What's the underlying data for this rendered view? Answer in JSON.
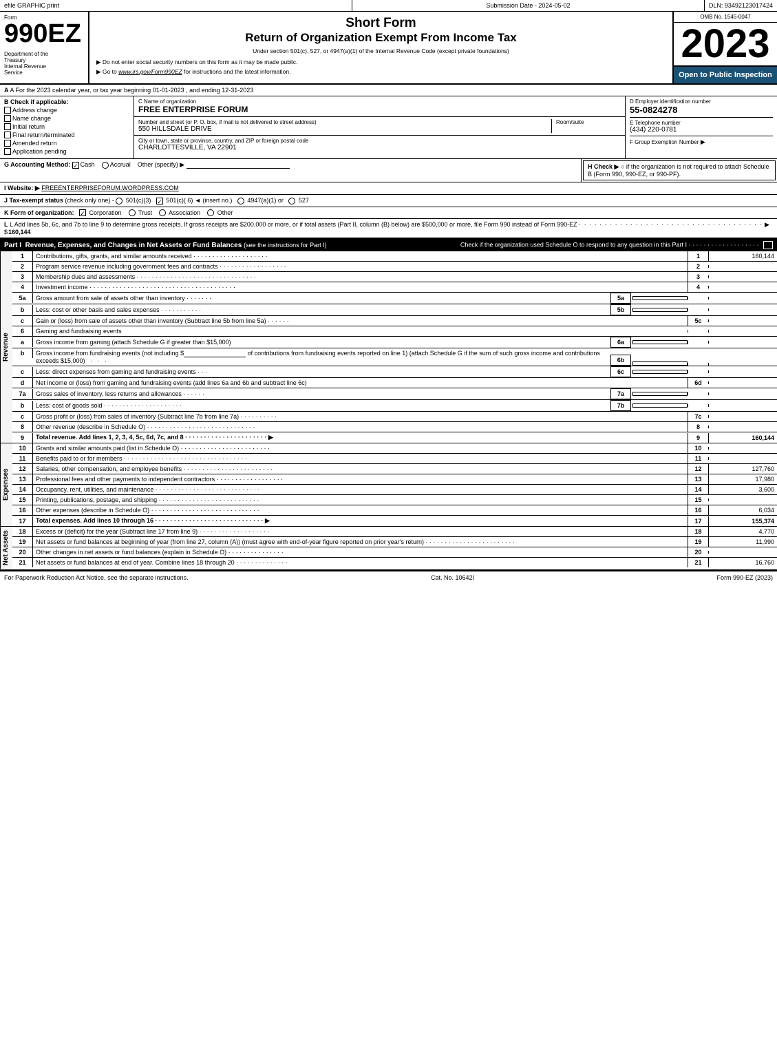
{
  "topbar": {
    "efile": "efile GRAPHIC print",
    "submission": "Submission Date - 2024-05-02",
    "dln": "DLN: 93492123017424"
  },
  "header": {
    "form_label": "Form",
    "form_number": "990EZ",
    "dept1": "Department of the",
    "dept2": "Treasury",
    "dept3": "Internal Revenue",
    "dept4": "Service",
    "short_form": "Short Form",
    "return_title": "Return of Organization Exempt From Income Tax",
    "subtitle": "Under section 501(c), 527, or 4947(a)(1) of the Internal Revenue Code (except private foundations)",
    "instruction1": "▶ Do not enter social security numbers on this form as it may be made public.",
    "instruction2": "▶ Go to www.irs.gov/Form990EZ for instructions and the latest information.",
    "omb": "OMB No. 1545-0047",
    "year": "2023",
    "open_public": "Open to Public Inspection"
  },
  "section_a": {
    "label": "A For the 2023 calendar year, or tax year beginning 01-01-2023 , and ending 12-31-2023"
  },
  "section_b": {
    "label": "B Check if applicable:",
    "checks": [
      {
        "id": "address_change",
        "label": "Address change",
        "checked": false
      },
      {
        "id": "name_change",
        "label": "Name change",
        "checked": false
      },
      {
        "id": "initial_return",
        "label": "Initial return",
        "checked": false
      },
      {
        "id": "final_return",
        "label": "Final return/terminated",
        "checked": false
      },
      {
        "id": "amended_return",
        "label": "Amended return",
        "checked": false
      },
      {
        "id": "app_pending",
        "label": "Application pending",
        "checked": false
      }
    ]
  },
  "org": {
    "c_label": "C Name of organization",
    "name": "FREE ENTERPRISE FORUM",
    "address_label": "Number and street (or P. O. box, if mail is not delivered to street address)",
    "address": "550 HILLSDALE DRIVE",
    "room_label": "Room/suite",
    "room": "",
    "city_label": "City or town, state or province, country, and ZIP or foreign postal code",
    "city": "CHARLOTTESVILLE, VA  22901",
    "d_label": "D Employer identification number",
    "ein": "55-0824278",
    "e_label": "E Telephone number",
    "phone": "(434) 220-0781",
    "f_label": "F Group Exemption",
    "f_label2": "Number",
    "f_val": "▶"
  },
  "section_g": {
    "label": "G Accounting Method:",
    "cash_label": "Cash",
    "cash_checked": true,
    "accrual_label": "Accrual",
    "accrual_checked": false,
    "other_label": "Other (specify) ▶",
    "other_val": ""
  },
  "section_h": {
    "label": "H Check ▶",
    "text": "○ if the organization is not required to attach Schedule B (Form 990, 990-EZ, or 990-PF)."
  },
  "section_i": {
    "label": "I Website: ▶",
    "url": "FREEENTERPRISEFORUM.WORDPRESS.COM"
  },
  "section_j": {
    "label": "J Tax-exempt status (check only one) - ○ 501(c)(3) ☑ 501(c)( 6) ◄ (insert no.) ○ 4947(a)(1) or ○ 527"
  },
  "section_k": {
    "label": "K Form of organization:",
    "corp_label": "Corporation",
    "corp_checked": true,
    "trust_label": "Trust",
    "trust_checked": false,
    "assoc_label": "Association",
    "assoc_checked": false,
    "other_label": "Other"
  },
  "section_l": {
    "text": "L Add lines 5b, 6c, and 7b to line 9 to determine gross receipts. If gross receipts are $200,000 or more, or if total assets (Part II, column (B) below) are $500,000 or more, file Form 990 instead of Form 990-EZ",
    "dots": "· · · · · · · · · · · · · · · · · · · · · · · · · · · · · · · · · · · · ▶ $",
    "amount": "160,144"
  },
  "part1": {
    "title": "Part I",
    "title_desc": "Revenue, Expenses, and Changes in Net Assets or Fund Balances",
    "title_see": "(see the instructions for Part I)",
    "check_note": "Check if the organization used Schedule O to respond to any question in this Part I",
    "lines": [
      {
        "num": "1",
        "desc": "Contributions, gifts, grants, and similar amounts received · · · · · · · · · · · · · · · · · · · ·",
        "col": "",
        "val": "160,144",
        "bold": false
      },
      {
        "num": "2",
        "desc": "Program service revenue including government fees and contracts · · · · · · · · · · · · · · · · · ·",
        "col": "",
        "val": "",
        "bold": false
      },
      {
        "num": "3",
        "desc": "Membership dues and assessments · · · · · · · · · · · · · · · · · · · · · · · · · · · · · · · ·",
        "col": "",
        "val": "",
        "bold": false
      },
      {
        "num": "4",
        "desc": "Investment income · · · · · · · · · · · · · · · · · · · · · · · · · · · · · · · · · · · · · · ·",
        "col": "",
        "val": "",
        "bold": false
      },
      {
        "num": "5a",
        "desc": "Gross amount from sale of assets other than inventory · · · · · · ·",
        "col": "5a",
        "val": "",
        "bold": false,
        "has_subcol": true
      },
      {
        "num": "b",
        "desc": "Less: cost or other basis and sales expenses · · · · · · · · · · ·",
        "col": "5b",
        "val": "",
        "bold": false,
        "has_subcol": true
      },
      {
        "num": "c",
        "desc": "Gain or (loss) from sale of assets other than inventory (Subtract line 5b from line 5a) · · · · · ·",
        "col": "",
        "val": "",
        "bold": false,
        "line_num_only": "5c"
      },
      {
        "num": "6",
        "desc": "Gaming and fundraising events",
        "col": "",
        "val": "",
        "bold": false,
        "header_only": true
      },
      {
        "num": "a",
        "desc": "Gross income from gaming (attach Schedule G if greater than $15,000)",
        "col": "6a",
        "val": "",
        "bold": false,
        "has_subcol": true
      },
      {
        "num": "b",
        "desc": "Gross income from fundraising events (not including $_____ of contributions from fundraising events reported on line 1) (attach Schedule G if the sum of such gross income and contributions exceeds $15,000)",
        "col": "6b",
        "val": "",
        "bold": false,
        "has_subcol": true,
        "multiline": true
      },
      {
        "num": "c",
        "desc": "Less: direct expenses from gaming and fundraising events · · ·",
        "col": "6c",
        "val": "",
        "bold": false,
        "has_subcol": true
      },
      {
        "num": "d",
        "desc": "Net income or (loss) from gaming and fundraising events (add lines 6a and 6b and subtract line 6c)",
        "col": "",
        "val": "",
        "bold": false,
        "line_num_only": "6d"
      },
      {
        "num": "7a",
        "desc": "Gross sales of inventory, less returns and allowances · · · · · ·",
        "col": "7a",
        "val": "",
        "bold": false,
        "has_subcol": true
      },
      {
        "num": "b",
        "desc": "Less: cost of goods sold · · · · · · · · · · · · · · · · · · · · ·",
        "col": "7b",
        "val": "",
        "bold": false,
        "has_subcol": true
      },
      {
        "num": "c",
        "desc": "Gross profit or (loss) from sales of inventory (Subtract line 7b from line 7a) · · · · · · · · · ·",
        "col": "",
        "val": "",
        "bold": false,
        "line_num_only": "7c"
      },
      {
        "num": "8",
        "desc": "Other revenue (describe in Schedule O) · · · · · · · · · · · · · · · · · · · · · · · · · · · · ·",
        "col": "",
        "val": "",
        "bold": false
      },
      {
        "num": "9",
        "desc": "Total revenue. Add lines 1, 2, 3, 4, 5c, 6d, 7c, and 8 · · · · · · · · · · · · · · · · · · · · · ·  ▶",
        "col": "",
        "val": "160,144",
        "bold": true
      }
    ]
  },
  "part1_expenses": {
    "lines": [
      {
        "num": "10",
        "desc": "Grants and similar amounts paid (list in Schedule O) · · · · · · · · · · · · · · · · · · · · · · · ·",
        "val": ""
      },
      {
        "num": "11",
        "desc": "Benefits paid to or for members · · · · · · · · · · · · · · · · · · · · · · · · · · · · · · · · ·",
        "val": ""
      },
      {
        "num": "12",
        "desc": "Salaries, other compensation, and employee benefits · · · · · · · · · · · · · · · · · · · · · · · ·",
        "val": "127,760"
      },
      {
        "num": "13",
        "desc": "Professional fees and other payments to independent contractors · · · · · · · · · · · · · · · · · ·",
        "val": "17,980"
      },
      {
        "num": "14",
        "desc": "Occupancy, rent, utilities, and maintenance · · · · · · · · · · · · · · · · · · · · · · · · · · · ·",
        "val": "3,600"
      },
      {
        "num": "15",
        "desc": "Printing, publications, postage, and shipping · · · · · · · · · · · · · · · · · · · · · · · · · · ·",
        "val": ""
      },
      {
        "num": "16",
        "desc": "Other expenses (describe in Schedule O) · · · · · · · · · · · · · · · · · · · · · · · · · · · · ·",
        "val": "6,034"
      },
      {
        "num": "17",
        "desc": "Total expenses. Add lines 10 through 16 · · · · · · · · · · · · · · · · · · · · · · · · · · · · · ▶",
        "val": "155,374",
        "bold": true
      }
    ]
  },
  "part1_assets": {
    "lines": [
      {
        "num": "18",
        "desc": "Excess or (deficit) for the year (Subtract line 17 from line 9) · · · · · · · · · · · · · · · · · · ·",
        "val": "4,770"
      },
      {
        "num": "19",
        "desc": "Net assets or fund balances at beginning of year (from line 27, column (A)) (must agree with end-of-year figure reported on prior year's return) · · · · · · · · · · · · · · · · · · · · · · · ·",
        "val": "11,990"
      },
      {
        "num": "20",
        "desc": "Other changes in net assets or fund balances (explain in Schedule O) · · · · · · · · · · · · · · ·",
        "val": ""
      },
      {
        "num": "21",
        "desc": "Net assets or fund balances at end of year. Combine lines 18 through 20 · · · · · · · · · · · · · ·",
        "val": "16,760"
      }
    ]
  },
  "footer": {
    "paperwork": "For Paperwork Reduction Act Notice, see the separate instructions.",
    "cat": "Cat. No. 10642I",
    "form": "Form 990-EZ (2023)"
  }
}
